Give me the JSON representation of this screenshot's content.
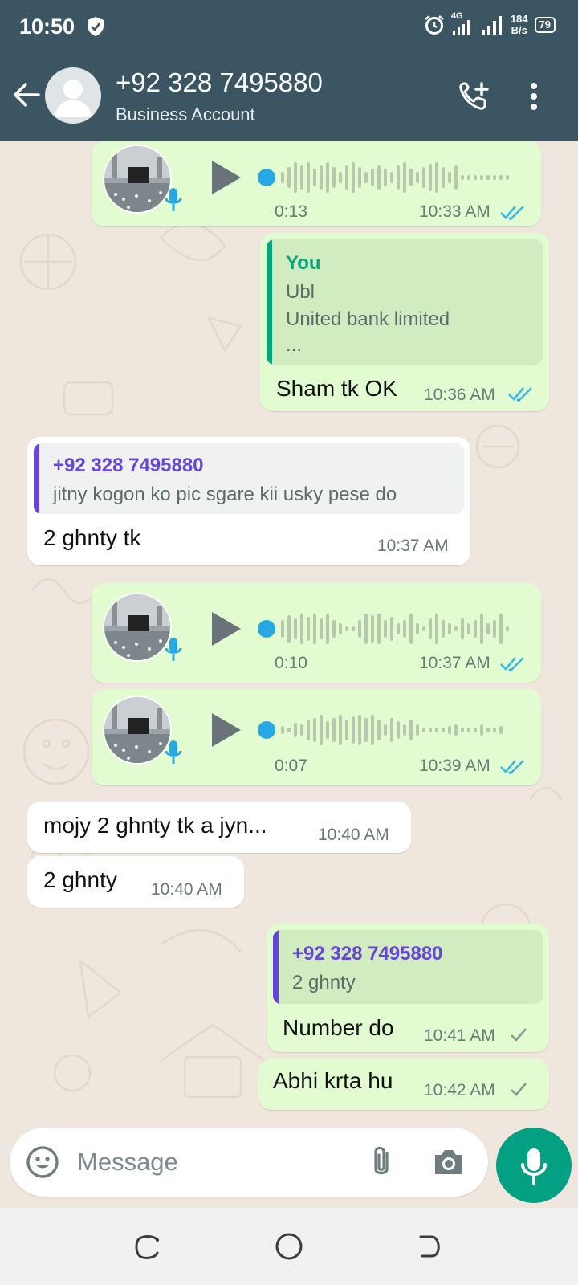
{
  "status_bar": {
    "time": "10:50",
    "network_label": "4G",
    "speed_value": "184",
    "speed_unit": "B/s",
    "battery": "79"
  },
  "header": {
    "contact_name": "+92 328 7495880",
    "contact_subtitle": "Business Account",
    "color": "#3b5563"
  },
  "messages": [
    {
      "kind": "voice",
      "direction": "outgoing",
      "duration": "0:13",
      "time": "10:33 AM",
      "status": "read"
    },
    {
      "kind": "text",
      "direction": "outgoing",
      "quote": {
        "author": "You",
        "lines": [
          "Ubl",
          "United bank limited",
          "..."
        ]
      },
      "text": "Sham tk OK",
      "time": "10:36 AM",
      "status": "read"
    },
    {
      "kind": "text",
      "direction": "incoming",
      "quote": {
        "author": "+92 328 7495880",
        "lines": [
          "jitny kogon ko pic sgare kii usky pese do"
        ]
      },
      "text": "2 ghnty tk",
      "time": "10:37 AM"
    },
    {
      "kind": "voice",
      "direction": "outgoing",
      "duration": "0:10",
      "time": "10:37 AM",
      "status": "read"
    },
    {
      "kind": "voice",
      "direction": "outgoing",
      "duration": "0:07",
      "time": "10:39 AM",
      "status": "read"
    },
    {
      "kind": "text",
      "direction": "incoming",
      "text": "mojy 2 ghnty tk a jyn...",
      "time": "10:40 AM"
    },
    {
      "kind": "text",
      "direction": "incoming",
      "text": "2 ghnty",
      "time": "10:40 AM"
    },
    {
      "kind": "text",
      "direction": "outgoing",
      "quote": {
        "author": "+92 328 7495880",
        "lines": [
          "2 ghnty"
        ]
      },
      "text": "Number do",
      "time": "10:41 AM",
      "status": "sent"
    },
    {
      "kind": "text",
      "direction": "outgoing",
      "text": "Abhi krta hu",
      "time": "10:42 AM",
      "status": "sent"
    }
  ],
  "composer": {
    "placeholder": "Message",
    "mic_color": "#03a084"
  },
  "colors": {
    "outgoing_bubble": "#e2fbd1",
    "incoming_bubble": "#ffffff",
    "read_tick": "#34b7f1",
    "quote_self": "#06a57d",
    "quote_contact": "#6745d6",
    "wallpaper": "#efe7de"
  }
}
